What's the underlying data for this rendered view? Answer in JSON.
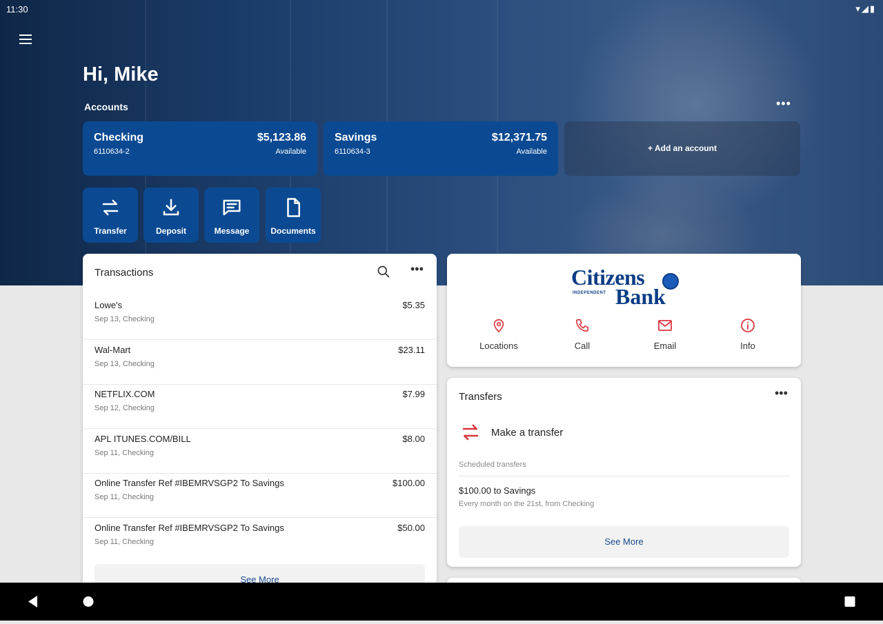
{
  "status_bar": {
    "time": "11:30",
    "icons": "▾◢▮"
  },
  "greeting": "Hi, Mike",
  "accounts": {
    "label": "Accounts",
    "more": "•••",
    "items": [
      {
        "name": "Checking",
        "number": "6110634-2",
        "balance": "$5,123.86",
        "balance_label": "Available"
      },
      {
        "name": "Savings",
        "number": "6110634-3",
        "balance": "$12,371.75",
        "balance_label": "Available"
      }
    ],
    "add_account": "+ Add an account"
  },
  "quick_actions": [
    {
      "label": "Transfer",
      "icon": "transfer-icon"
    },
    {
      "label": "Deposit",
      "icon": "deposit-icon"
    },
    {
      "label": "Message",
      "icon": "message-icon"
    },
    {
      "label": "Documents",
      "icon": "document-icon"
    }
  ],
  "transactions": {
    "title": "Transactions",
    "more": "•••",
    "rows": [
      {
        "merchant": "Lowe's",
        "detail": "Sep 13, Checking",
        "amount": "$5.35"
      },
      {
        "merchant": "Wal-Mart",
        "detail": "Sep 13, Checking",
        "amount": "$23.11"
      },
      {
        "merchant": "NETFLIX.COM",
        "detail": "Sep 12, Checking",
        "amount": "$7.99"
      },
      {
        "merchant": "APL ITUNES.COM/BILL",
        "detail": "Sep 11, Checking",
        "amount": "$8.00"
      },
      {
        "merchant": "Online Transfer Ref #IBEMRVSGP2 To Savings",
        "detail": "Sep 11, Checking",
        "amount": "$100.00"
      },
      {
        "merchant": "Online Transfer Ref #IBEMRVSGP2 To Savings",
        "detail": "Sep 11, Checking",
        "amount": "$50.00"
      }
    ],
    "see_more": "See More"
  },
  "bank": {
    "logo_word1": "Citizens",
    "logo_word2": "Bank",
    "logo_small": "INDEPENDENT",
    "contacts": [
      {
        "label": "Locations",
        "icon": "location-pin-icon"
      },
      {
        "label": "Call",
        "icon": "phone-icon"
      },
      {
        "label": "Email",
        "icon": "email-icon"
      },
      {
        "label": "Info",
        "icon": "info-icon"
      }
    ]
  },
  "transfers": {
    "title": "Transfers",
    "more": "•••",
    "make_transfer": "Make a transfer",
    "scheduled_label": "Scheduled transfers",
    "scheduled": [
      {
        "title": "$100.00 to Savings",
        "subtitle": "Every month on the 21st, from Checking"
      }
    ],
    "see_more": "See More"
  },
  "colors": {
    "brand_blue": "#0b4a92",
    "accent_red": "#d9363e",
    "link_blue": "#1a4a8a"
  }
}
